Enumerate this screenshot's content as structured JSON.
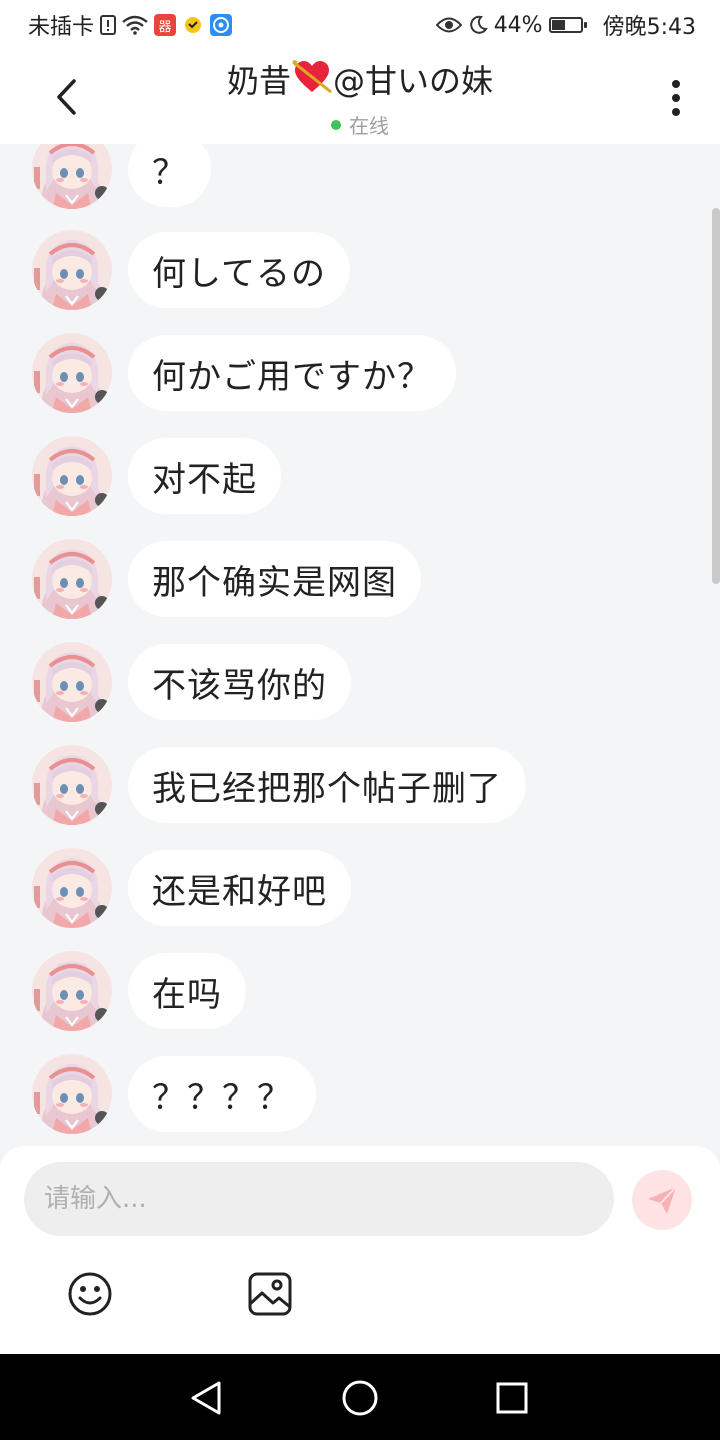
{
  "status_bar": {
    "carrier": "未插卡",
    "app_badge_1": "器",
    "battery": "44%",
    "battery_level": 0.44,
    "time": "傍晚5:43"
  },
  "header": {
    "title_prefix": "奶昔",
    "title_suffix": "@甘いの妹",
    "status": "在线"
  },
  "messages": [
    {
      "text": "？"
    },
    {
      "text": "何してるの"
    },
    {
      "text": "何かご用ですか？"
    },
    {
      "text": "对不起"
    },
    {
      "text": "那个确实是网图"
    },
    {
      "text": "不该骂你的"
    },
    {
      "text": "我已经把那个帖子删了"
    },
    {
      "text": "还是和好吧"
    },
    {
      "text": "在吗"
    },
    {
      "text": "？？？？"
    }
  ],
  "composer": {
    "placeholder": "请输入..."
  },
  "colors": {
    "accent": "#f28b8b",
    "online": "#3dc45a",
    "background": "#f4f5f7"
  }
}
